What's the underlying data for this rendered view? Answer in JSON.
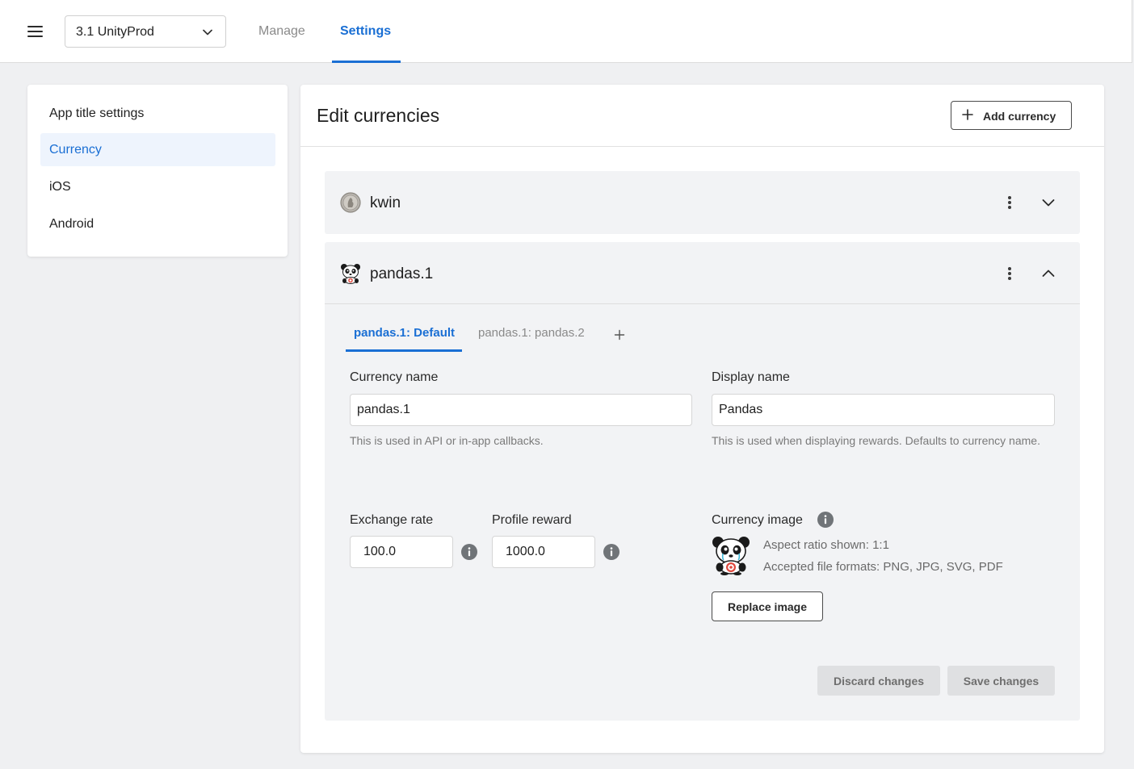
{
  "header": {
    "project_selector": "3.1 UnityProd",
    "tabs": [
      {
        "label": "Manage",
        "active": false
      },
      {
        "label": "Settings",
        "active": true
      }
    ]
  },
  "sidebar": {
    "items": [
      {
        "label": "App title settings",
        "active": false
      },
      {
        "label": "Currency",
        "active": true
      },
      {
        "label": "iOS",
        "active": false
      },
      {
        "label": "Android",
        "active": false
      }
    ]
  },
  "main": {
    "title": "Edit currencies",
    "add_button": "Add currency",
    "currencies": [
      {
        "name": "kwin",
        "icon": "coin-icon",
        "expanded": false
      },
      {
        "name": "pandas.1",
        "icon": "panda-icon",
        "expanded": true
      }
    ]
  },
  "editor": {
    "tabs": [
      {
        "label": "pandas.1: Default",
        "active": true
      },
      {
        "label": "pandas.1: pandas.2",
        "active": false
      }
    ],
    "currency_name": {
      "label": "Currency name",
      "value": "pandas.1",
      "help": "This is used in API or in-app callbacks."
    },
    "display_name": {
      "label": "Display name",
      "value": "Pandas",
      "help": "This is used when displaying rewards. Defaults to currency name."
    },
    "exchange_rate": {
      "label": "Exchange rate",
      "value": "100.0"
    },
    "profile_reward": {
      "label": "Profile reward",
      "value": "1000.0"
    },
    "currency_image": {
      "label": "Currency image",
      "aspect": "Aspect ratio shown: 1:1",
      "formats": "Accepted file formats: PNG, JPG, SVG, PDF",
      "replace_button": "Replace image"
    },
    "discard_button": "Discard changes",
    "save_button": "Save changes"
  },
  "colors": {
    "accent": "#1a6fd4",
    "background": "#eff0f2",
    "panel": "#f2f3f5"
  }
}
